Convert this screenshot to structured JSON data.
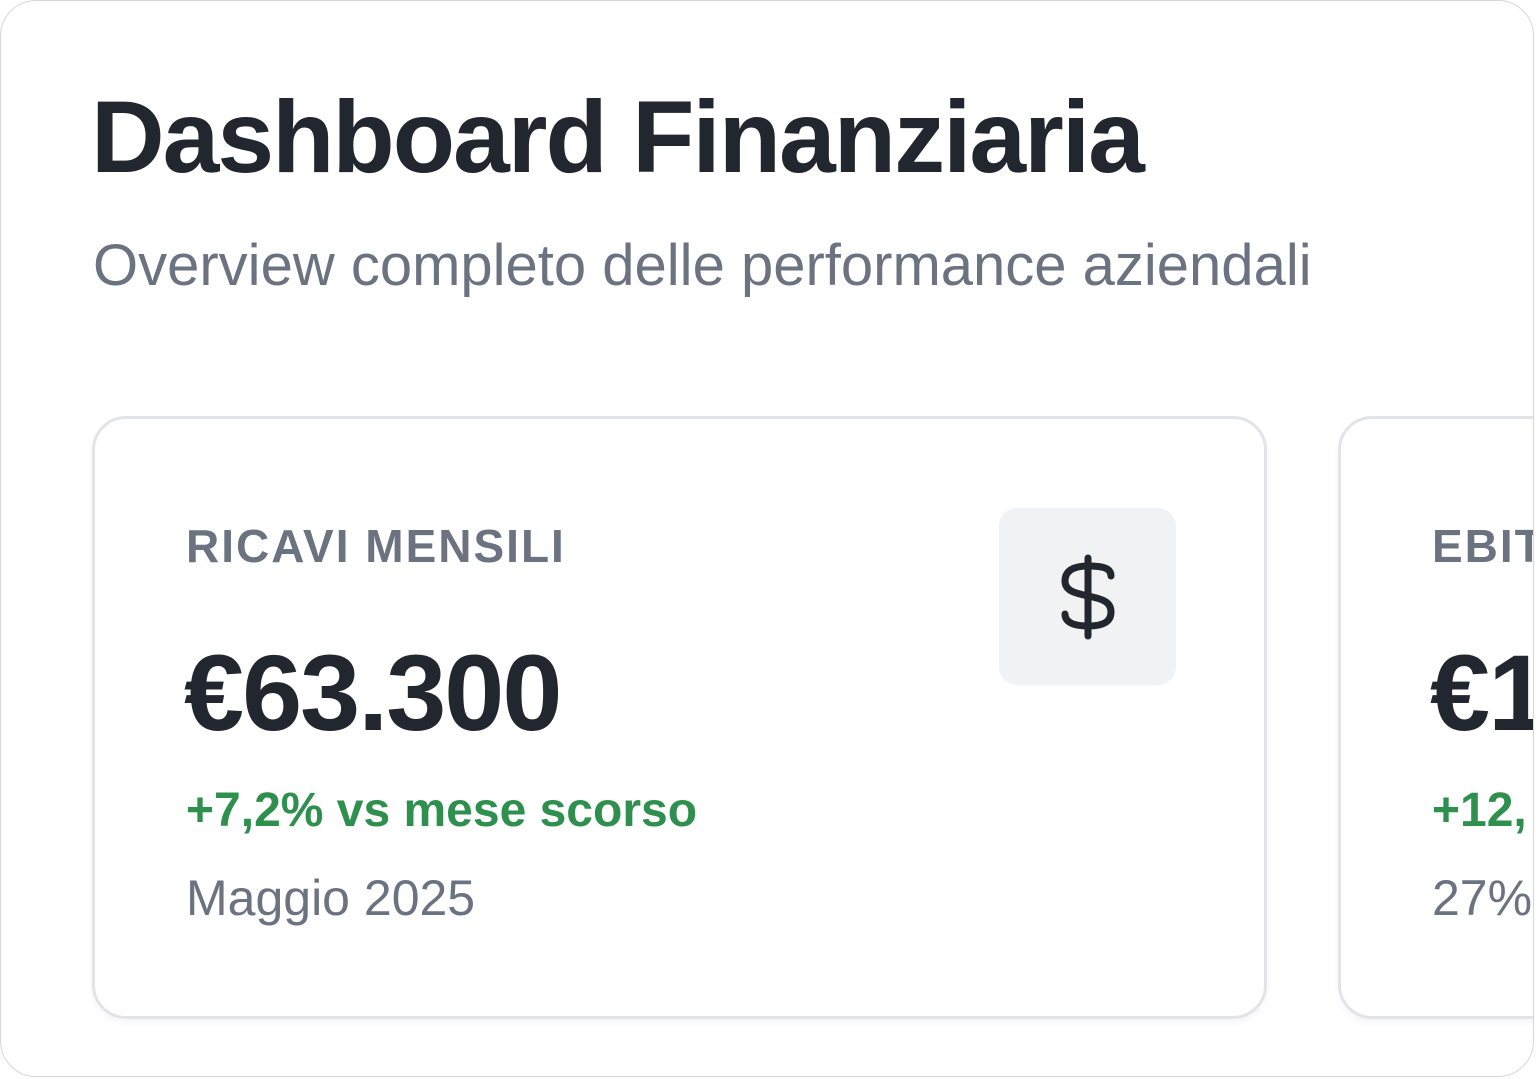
{
  "header": {
    "title": "Dashboard Finanziaria",
    "subtitle": "Overview completo delle performance aziendali"
  },
  "cards": [
    {
      "label": "RICAVI MENSILI",
      "value": "€63.300",
      "change": "+7,2% vs mese scorso",
      "period": "Maggio 2025",
      "icon": "dollar-icon"
    },
    {
      "label": "EBIT",
      "value": "€1",
      "change": "+12,",
      "period": "27%"
    }
  ],
  "colors": {
    "title": "#22262e",
    "muted": "#6b7280",
    "positive": "#2f8f4e",
    "card_border": "#e2e4e8",
    "icon_bg": "#f1f2f4"
  }
}
